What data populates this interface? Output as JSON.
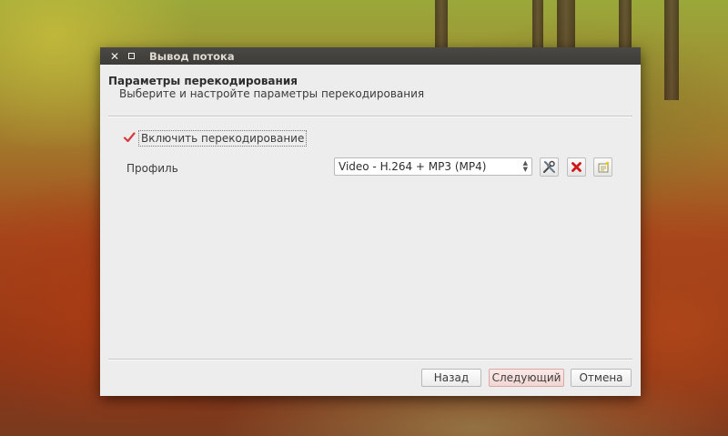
{
  "window": {
    "title": "Вывод потока"
  },
  "header": {
    "title": "Параметры перекодирования",
    "subtitle": "Выберите и настройте параметры перекодирования"
  },
  "transcode": {
    "enable_label": "Включить перекодирование",
    "enabled": true,
    "profile_label": "Профиль",
    "profile_value": "Video - H.264 + MP3 (MP4)"
  },
  "tools": {
    "edit_icon": "tools-icon",
    "delete_icon": "delete-red-x-icon",
    "new_icon": "new-profile-icon"
  },
  "buttons": {
    "back": "Назад",
    "next": "Следующий",
    "cancel": "Отмена"
  },
  "colors": {
    "titlebar": "#3c3b37",
    "check": "#d63b3b",
    "default_button": "#f2d6d3"
  }
}
